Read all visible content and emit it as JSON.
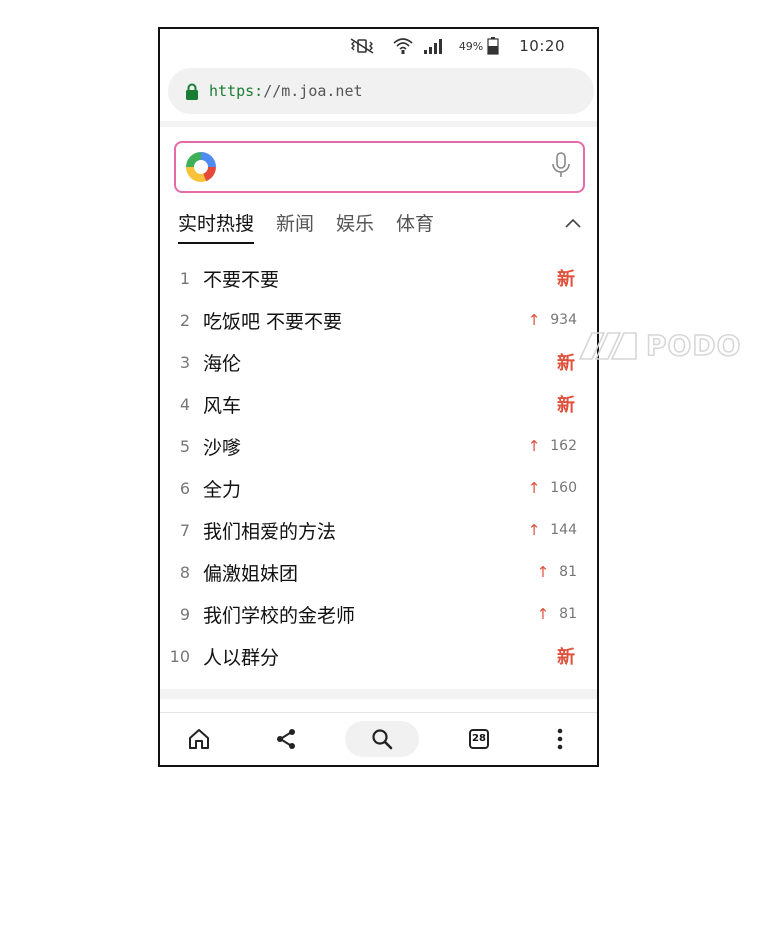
{
  "status_bar": {
    "battery_percent": "49%",
    "time": "10:20"
  },
  "url_bar": {
    "scheme": "https:",
    "rest": "//m.joa.net"
  },
  "search": {
    "placeholder": "",
    "value": ""
  },
  "tabs": [
    {
      "label": "实时热搜",
      "active": true
    },
    {
      "label": "新闻",
      "active": false
    },
    {
      "label": "娱乐",
      "active": false
    },
    {
      "label": "体育",
      "active": false
    }
  ],
  "hot_list": [
    {
      "rank": "1",
      "keyword": "不要不要",
      "tag": "新"
    },
    {
      "rank": "2",
      "keyword": "吃饭吧 不要不要",
      "trend": "934"
    },
    {
      "rank": "3",
      "keyword": "海伦",
      "tag": "新"
    },
    {
      "rank": "4",
      "keyword": "风车",
      "tag": "新"
    },
    {
      "rank": "5",
      "keyword": "沙嗲",
      "trend": "162"
    },
    {
      "rank": "6",
      "keyword": "全力",
      "trend": "160"
    },
    {
      "rank": "7",
      "keyword": "我们相爱的方法",
      "trend": "144"
    },
    {
      "rank": "8",
      "keyword": "偏激姐妹团",
      "trend": "81"
    },
    {
      "rank": "9",
      "keyword": "我们学校的金老师",
      "trend": "81"
    },
    {
      "rank": "10",
      "keyword": "人以群分",
      "tag": "新"
    }
  ],
  "bottom_nav": {
    "tab_count": "28"
  },
  "watermark": {
    "text": "PODO"
  },
  "colors": {
    "accent_pink": "#e46aa8",
    "new_tag_red": "#e0513c",
    "secure_green": "#1a7d34"
  }
}
